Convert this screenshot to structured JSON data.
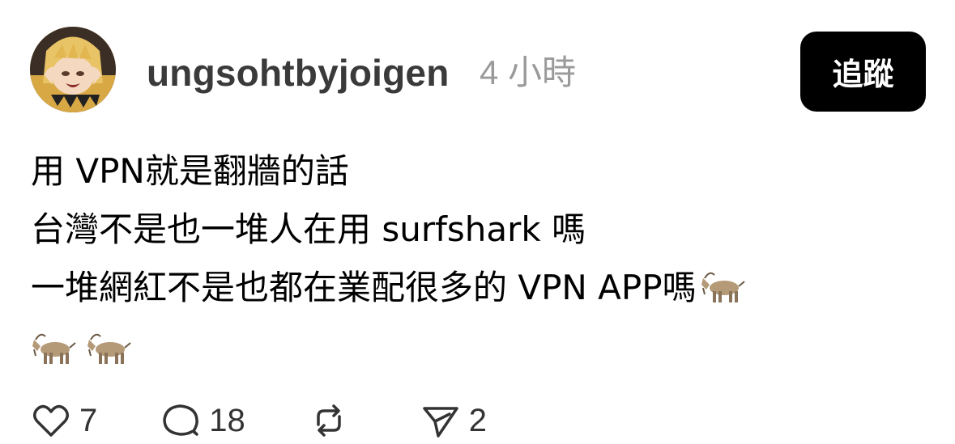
{
  "post": {
    "username": "ungsohtbyjoigen",
    "time": "4 小時",
    "follow_label": "追蹤",
    "lines": [
      "用 VPN就是翻牆的話",
      "台灣不是也一堆人在用 surfshark 嗎",
      "一堆網紅不是也都在業配很多的 VPN APP嗎"
    ],
    "trailing_emoji": "🐐",
    "emoji_row": [
      "🐐",
      "🐐"
    ]
  },
  "actions": {
    "likes": "7",
    "replies": "18",
    "reposts": "",
    "shares": "2"
  },
  "icons": {
    "like": "heart-icon",
    "reply": "speech-bubble-icon",
    "repost": "repost-arrows-icon",
    "share": "paper-plane-icon",
    "emoji": "goat-emoji"
  }
}
